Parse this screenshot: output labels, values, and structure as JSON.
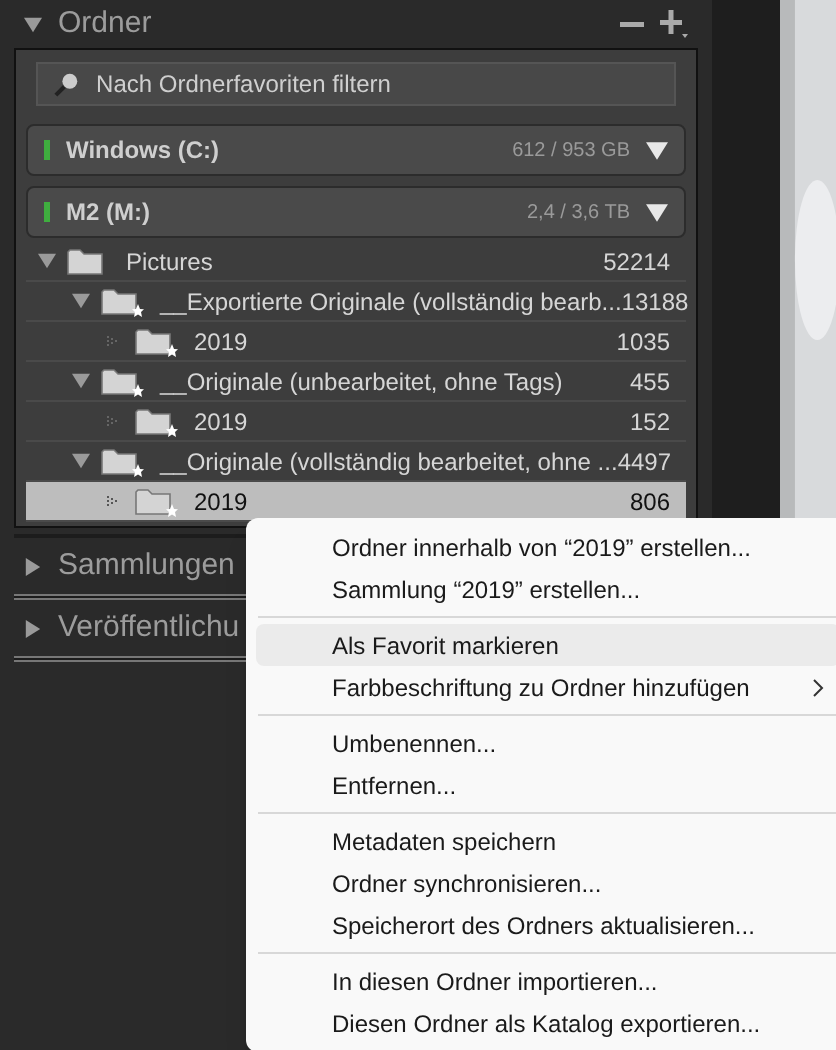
{
  "panel": {
    "title": "Ordner",
    "expanded": true,
    "search": {
      "placeholder": "Nach Ordnerfavoriten filtern"
    },
    "volumes": [
      {
        "name": "Windows (C:)",
        "usage": "612 / 953 GB",
        "color": "#3fae3f"
      },
      {
        "name": "M2 (M:)",
        "usage": "2,4 / 3,6 TB",
        "color": "#3fae3f"
      }
    ],
    "tree": [
      {
        "name": "Pictures",
        "count": "52214",
        "expanded": true,
        "favorite": false,
        "selected": false,
        "children": [
          {
            "name": "__Exportierte Originale (vollständig bearb...",
            "count": "13188",
            "expanded": true,
            "favorite": true,
            "selected": false,
            "children": [
              {
                "name": "2019",
                "count": "1035",
                "favorite": true,
                "selected": false
              }
            ]
          },
          {
            "name": "__Originale (unbearbeitet, ohne Tags)",
            "count": "455",
            "expanded": true,
            "favorite": true,
            "selected": false,
            "children": [
              {
                "name": "2019",
                "count": "152",
                "favorite": true,
                "selected": false
              }
            ]
          },
          {
            "name": "__Originale (vollständig bearbeitet, ohne ...",
            "count": "4497",
            "expanded": true,
            "favorite": true,
            "selected": false,
            "children": [
              {
                "name": "2019",
                "count": "806",
                "favorite": true,
                "selected": true
              }
            ]
          }
        ]
      }
    ]
  },
  "sections": [
    {
      "title": "Sammlungen",
      "expanded": false
    },
    {
      "title": "Veröffentlichu",
      "expanded": false
    }
  ],
  "context_menu": {
    "groups": [
      [
        {
          "label": "Ordner innerhalb von “2019” erstellen...",
          "highlighted": false
        },
        {
          "label": "Sammlung “2019” erstellen...",
          "highlighted": false
        }
      ],
      [
        {
          "label": "Als Favorit markieren",
          "highlighted": true
        },
        {
          "label": "Farbbeschriftung zu Ordner hinzufügen",
          "highlighted": false,
          "submenu": true
        }
      ],
      [
        {
          "label": "Umbenennen...",
          "highlighted": false
        },
        {
          "label": "Entfernen...",
          "highlighted": false
        }
      ],
      [
        {
          "label": "Metadaten speichern",
          "highlighted": false
        },
        {
          "label": "Ordner synchronisieren...",
          "highlighted": false
        },
        {
          "label": "Speicherort des Ordners aktualisieren...",
          "highlighted": false
        }
      ],
      [
        {
          "label": "In diesen Ordner importieren...",
          "highlighted": false
        },
        {
          "label": "Diesen Ordner als Katalog exportieren...",
          "highlighted": false
        }
      ]
    ]
  }
}
